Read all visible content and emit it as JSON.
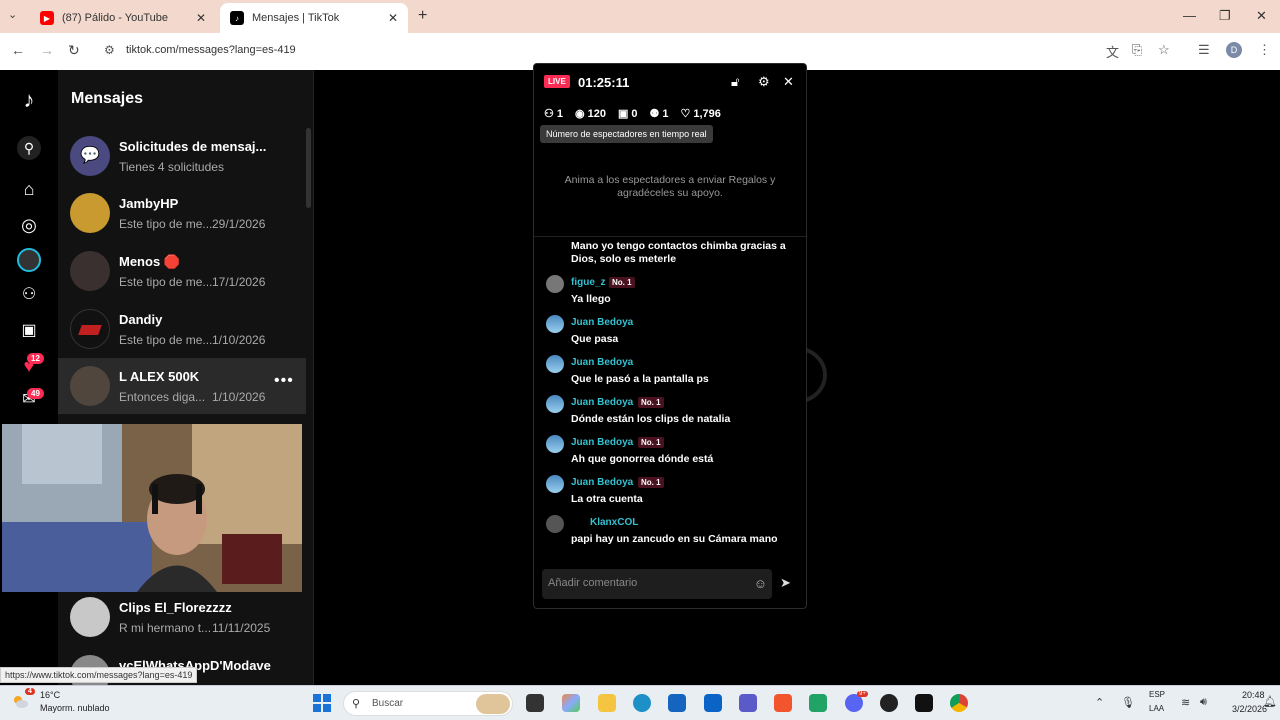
{
  "browser": {
    "tabs": [
      {
        "title": "(87) Pálido - YouTube",
        "favicon": "youtube-icon",
        "color": "#ff0000"
      },
      {
        "title": "Mensajes | TikTok",
        "favicon": "tiktok-icon",
        "color": "#000000"
      }
    ],
    "url": "tiktok.com/messages?lang=es-419",
    "profile_initial": "D"
  },
  "rail": {
    "items": [
      "tiktok-logo-icon",
      "search-icon",
      "home-icon",
      "explore-icon",
      "following-icon",
      "friends-icon",
      "live-icon",
      "activity-icon",
      "messages-icon"
    ],
    "activity_badge": "12",
    "messages_badge": "49"
  },
  "messages": {
    "title": "Mensajes",
    "conversations": [
      {
        "name": "Solicitudes de mensaj...",
        "preview": "Tienes 4 solicitudes",
        "date": "",
        "avatar_color": "#5a5a9a"
      },
      {
        "name": "JambyHP",
        "preview": "Este tipo de me...",
        "date": "29/1/2026",
        "avatar_color": "#c89a30"
      },
      {
        "name": "Menos 🛑",
        "preview": "Este tipo de me...",
        "date": "17/1/2026",
        "avatar_color": "#3a3030"
      },
      {
        "name": "Dandiy",
        "preview": "Este tipo de me...",
        "date": "1/10/2026",
        "avatar_color": "#c02020"
      },
      {
        "name": "L ALEX 500K",
        "preview": "Entonces diga...",
        "date": "1/10/2026",
        "avatar_color": "#50463e"
      },
      {
        "name": "Clips El_Florezzzz",
        "preview": "R mi hermano t...",
        "date": "11/11/2025",
        "avatar_color": "#c8c8c8"
      },
      {
        "name": "vcElWhatsAppD'Modave",
        "preview": "",
        "date": "",
        "avatar_color": "#888888"
      }
    ]
  },
  "live": {
    "badge": "LIVE",
    "time": "01:25:11",
    "stats": [
      {
        "icon": "viewers-icon",
        "value": "1"
      },
      {
        "icon": "eye-icon",
        "value": "120"
      },
      {
        "icon": "gift-icon",
        "value": "0"
      },
      {
        "icon": "user-plus-icon",
        "value": "1"
      },
      {
        "icon": "heart-icon",
        "value": "1,796"
      }
    ],
    "tooltip": "Número de espectadores en tiempo real",
    "hint": "Anima a los espectadores a enviar Regalos y agradéceles su apoyo.",
    "chat_top": "Mano yo tengo contactos chimba gracias a Dios, solo es meterle",
    "chat": [
      {
        "user": "figue_z",
        "rank": "No. 1",
        "text": "Ya llego"
      },
      {
        "user": "Juan Bedoya",
        "rank": "",
        "text": "Que pasa"
      },
      {
        "user": "Juan Bedoya",
        "rank": "",
        "text": "Que le pasó a la pantalla ps"
      },
      {
        "user": "Juan Bedoya",
        "rank": "No. 1",
        "text": "Dónde están los clips de natalia"
      },
      {
        "user": "Juan Bedoya",
        "rank": "No. 1",
        "text": "Ah que gonorrea dónde está"
      },
      {
        "user": "Juan Bedoya",
        "rank": "No. 1",
        "text": "La otra cuenta"
      },
      {
        "user": "KlanxCOL",
        "rank": "",
        "text": "papi hay un zancudo en su Cámara mano"
      }
    ],
    "comment_placeholder": "Añadir comentario"
  },
  "status_url": "https://www.tiktok.com/messages?lang=es-419",
  "taskbar": {
    "weather_badge": "4",
    "temp": "16°C",
    "weather": "Mayorm. nublado",
    "search_label": "Buscar",
    "lang1": "ESP",
    "lang2": "LAA",
    "time": "20:48",
    "date": "3/2/2026",
    "discord_badge": "9+"
  }
}
